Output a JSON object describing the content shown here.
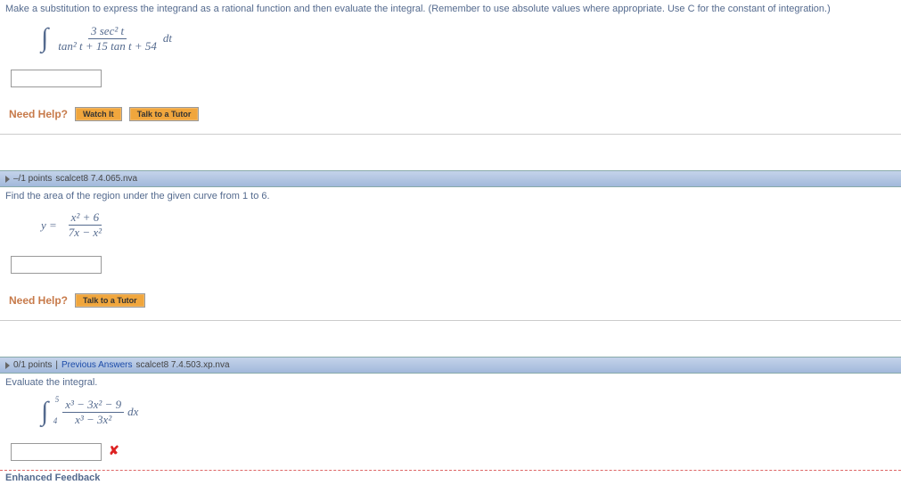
{
  "q1": {
    "prompt": "Make a substitution to express the integrand as a rational function and then evaluate the integral. (Remember to use absolute values where appropriate. Use C for the constant of integration.)",
    "integrand_num": "3 sec² t",
    "integrand_den": "tan² t + 15 tan t + 54",
    "diff": "dt",
    "help_label": "Need Help?",
    "watch_btn": "Watch It",
    "tutor_btn": "Talk to a Tutor"
  },
  "q2": {
    "header_points": "–/1 points",
    "header_ref": "scalcet8 7.4.065.nva",
    "prompt": "Find the area of the region under the given curve from 1 to 6.",
    "lhs": "y =",
    "num": "x² + 6",
    "den": "7x − x²",
    "help_label": "Need Help?",
    "tutor_btn": "Talk to a Tutor"
  },
  "q3": {
    "header_points": "0/1 points",
    "header_sep": "|",
    "header_prev": "Previous Answers",
    "header_ref": "scalcet8 7.4.503.xp.nva",
    "prompt": "Evaluate the integral.",
    "upper": "5",
    "lower": "4",
    "num": "x³ − 3x² − 9",
    "den": "x³ − 3x²",
    "diff": "dx",
    "incorrect": "✘",
    "feedback": "Enhanced Feedback"
  }
}
